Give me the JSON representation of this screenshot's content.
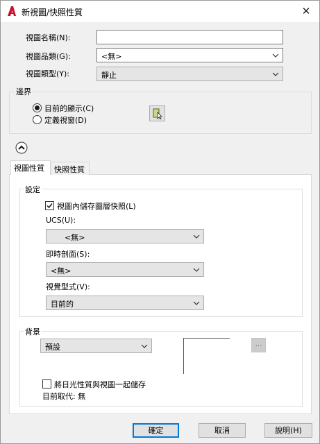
{
  "window": {
    "title": "新視圖/快照性質",
    "close_glyph": "✕"
  },
  "view_name": {
    "label": "視圖名稱(N):",
    "value": ""
  },
  "view_category": {
    "label": "視圖品類(G):",
    "value": "<無>"
  },
  "view_type": {
    "label": "視圖類型(Y):",
    "value": "靜止"
  },
  "boundary": {
    "title": "邊界",
    "current_display": {
      "label": "目前的顯示(C)",
      "selected": true
    },
    "define_window": {
      "label": "定義視窗(D)",
      "selected": false
    },
    "pick_icon": "pick-window-icon"
  },
  "tabs": [
    {
      "label": "視圖性質",
      "active": true
    },
    {
      "label": "快照性質",
      "active": false
    }
  ],
  "settings": {
    "title": "設定",
    "save_layer_snapshot": {
      "label": "視圖內儲存圖層快照(L)",
      "checked": true
    },
    "ucs": {
      "label": "UCS(U):",
      "value": "<無>"
    },
    "live_section": {
      "label": "即時剖面(S):",
      "value": "<無>"
    },
    "visual_style": {
      "label": "視覺型式(V):",
      "value": "目前的"
    }
  },
  "background": {
    "title": "背景",
    "value": "預設",
    "browse_label": "...",
    "save_sun": {
      "label": "將日光性質與視圖一起儲存",
      "checked": false
    },
    "current_override": "目前取代: 無"
  },
  "buttons": {
    "ok": "確定",
    "cancel": "取消",
    "help": "說明(H)"
  },
  "colors": {
    "accent": "#0078d7",
    "app_icon": "#c8102e"
  }
}
